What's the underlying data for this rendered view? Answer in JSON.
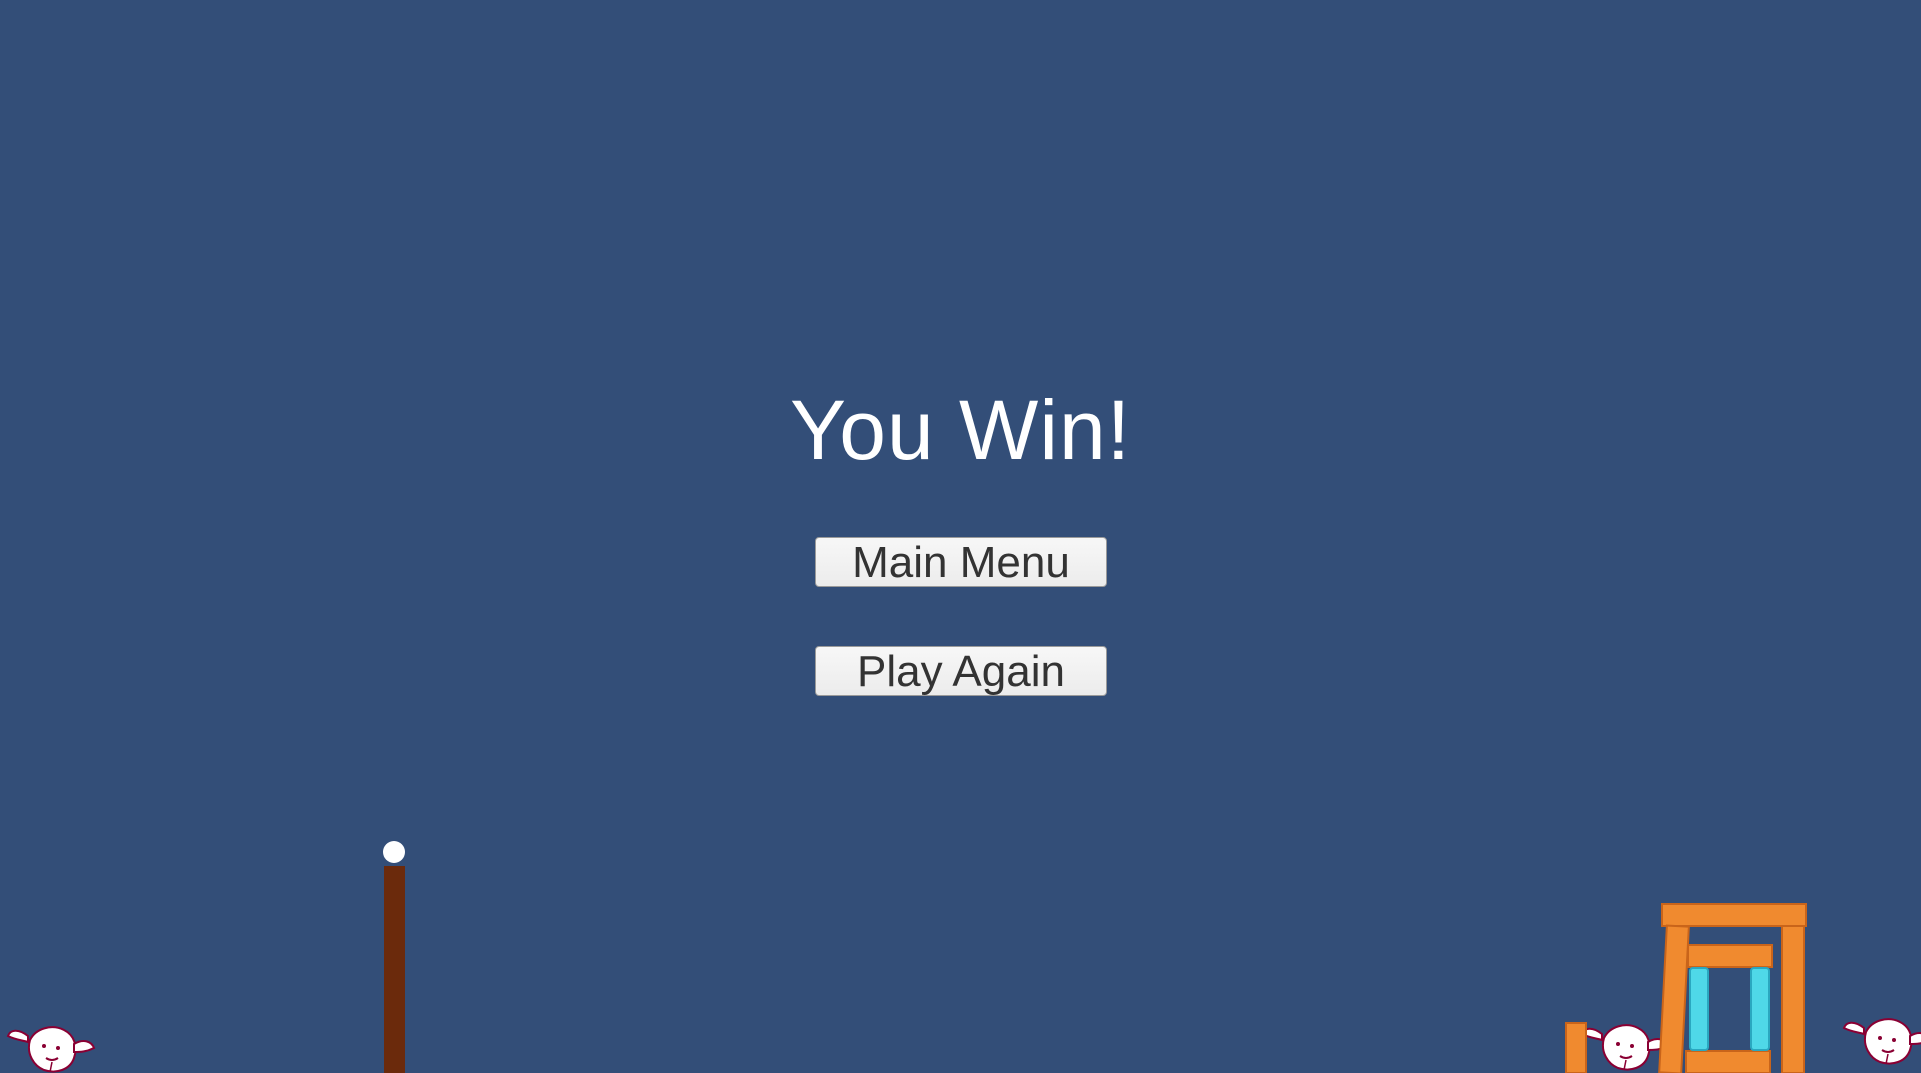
{
  "screen": {
    "title": "You Win!",
    "buttons": {
      "main_menu": "Main Menu",
      "play_again": "Play Again"
    }
  },
  "colors": {
    "background": "#334e78",
    "pole": "#6b2a0c",
    "ball": "#ffffff",
    "wood": "#f08a2f",
    "ice": "#4fd8e8",
    "creature_outline": "#8a0033"
  },
  "icons": {
    "projectile": "ball-icon",
    "creature": "creature-face-icon"
  }
}
